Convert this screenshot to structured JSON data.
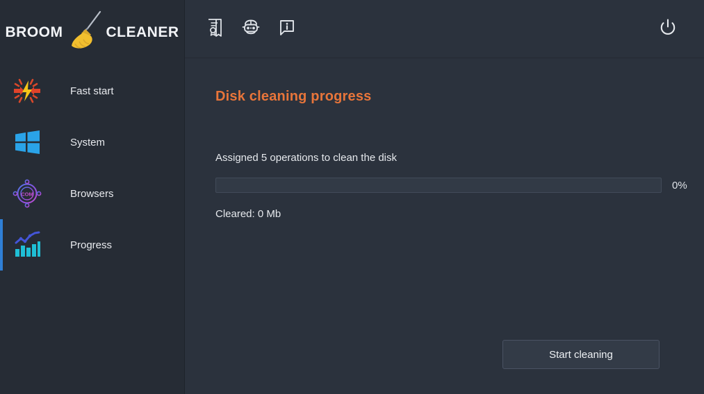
{
  "app": {
    "brand_left": "BROOM",
    "brand_right": "CLEANER",
    "accent_color": "#e8753a",
    "active_indicator_color": "#2f7fd6",
    "sidebar_bg": "#262c35",
    "main_bg": "#2b323d"
  },
  "sidebar": {
    "items": [
      {
        "label": "Fast start",
        "icon": "lightning-bolt-icon",
        "active": false
      },
      {
        "label": "System",
        "icon": "windows-logo-icon",
        "active": false
      },
      {
        "label": "Browsers",
        "icon": "compass-com-icon",
        "active": false
      },
      {
        "label": "Progress",
        "icon": "bar-chart-trend-icon",
        "active": true
      }
    ]
  },
  "topbar": {
    "icons": [
      {
        "name": "certificate-icon",
        "title": "License"
      },
      {
        "name": "robot-icon",
        "title": "Bot"
      },
      {
        "name": "info-bubble-icon",
        "title": "Info"
      }
    ],
    "power": {
      "name": "power-icon",
      "title": "Exit"
    }
  },
  "main": {
    "title": "Disk cleaning progress",
    "operations_text": "Assigned 5 operations to clean the disk",
    "progress_percent_label": "0%",
    "progress_value": 0,
    "cleared_text": "Cleared: 0 Mb",
    "start_button": "Start cleaning"
  }
}
